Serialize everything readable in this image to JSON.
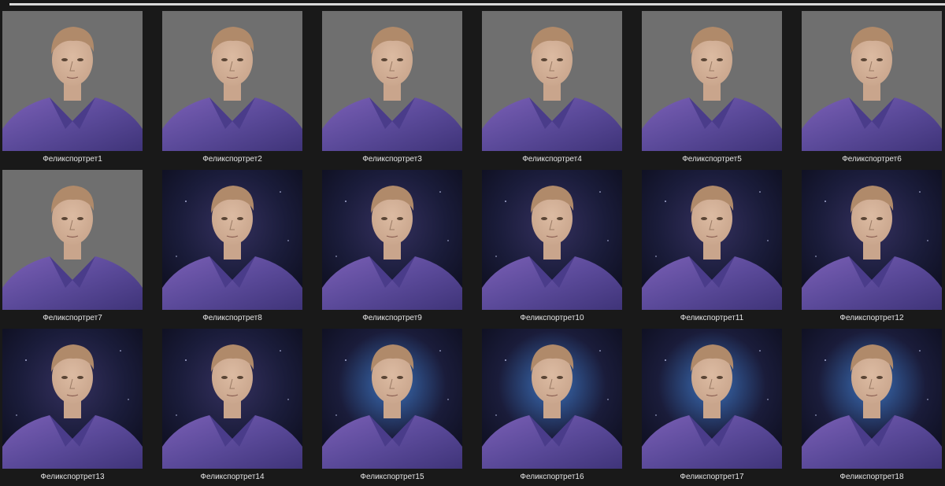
{
  "explorer": {
    "items": [
      {
        "name": "Феликспортрет1",
        "bg": "plain"
      },
      {
        "name": "Феликспортрет2",
        "bg": "plain"
      },
      {
        "name": "Феликспортрет3",
        "bg": "plain"
      },
      {
        "name": "Феликспортрет4",
        "bg": "plain"
      },
      {
        "name": "Феликспортрет5",
        "bg": "plain"
      },
      {
        "name": "Феликспортрет6",
        "bg": "plain"
      },
      {
        "name": "Феликспортрет7",
        "bg": "plain"
      },
      {
        "name": "Феликспортрет8",
        "bg": "space"
      },
      {
        "name": "Феликспортрет9",
        "bg": "space"
      },
      {
        "name": "Феликспортрет10",
        "bg": "space"
      },
      {
        "name": "Феликспортрет11",
        "bg": "space"
      },
      {
        "name": "Феликспортрет12",
        "bg": "space"
      },
      {
        "name": "Феликспортрет13",
        "bg": "space"
      },
      {
        "name": "Феликспортрет14",
        "bg": "space"
      },
      {
        "name": "Феликспортрет15",
        "bg": "space-glow"
      },
      {
        "name": "Феликспортрет16",
        "bg": "space-glow"
      },
      {
        "name": "Феликспортрет17",
        "bg": "space-glow"
      },
      {
        "name": "Феликспортрет18",
        "bg": "space-glow"
      }
    ]
  },
  "colors": {
    "window_bg": "#191919",
    "label_text": "#e6e6e6",
    "plain_bg": "#6f6f6f",
    "space_bg": "#1a1c3a",
    "shirt": "#5b4a9a",
    "skin": "#c9a58c",
    "hair": "#b08a6a"
  }
}
